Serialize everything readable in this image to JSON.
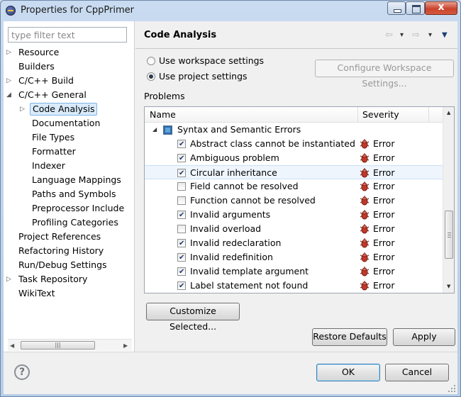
{
  "window": {
    "title": "Properties for CppPrimer",
    "close_glyph": "x"
  },
  "filter": {
    "placeholder": "type filter text"
  },
  "tree": [
    {
      "label": "Resource",
      "twisty": "▷"
    },
    {
      "label": "Builders",
      "twisty": ""
    },
    {
      "label": "C/C++ Build",
      "twisty": "▷"
    },
    {
      "label": "C/C++ General",
      "twisty": "◢"
    },
    {
      "label": "Code Analysis",
      "twisty": "▷"
    },
    {
      "label": "Documentation",
      "twisty": ""
    },
    {
      "label": "File Types",
      "twisty": ""
    },
    {
      "label": "Formatter",
      "twisty": ""
    },
    {
      "label": "Indexer",
      "twisty": ""
    },
    {
      "label": "Language Mappings",
      "twisty": ""
    },
    {
      "label": "Paths and Symbols",
      "twisty": ""
    },
    {
      "label": "Preprocessor Include",
      "twisty": ""
    },
    {
      "label": "Profiling Categories",
      "twisty": ""
    },
    {
      "label": "Project References",
      "twisty": ""
    },
    {
      "label": "Refactoring History",
      "twisty": ""
    },
    {
      "label": "Run/Debug Settings",
      "twisty": ""
    },
    {
      "label": "Task Repository",
      "twisty": "▷"
    },
    {
      "label": "WikiText",
      "twisty": ""
    }
  ],
  "page": {
    "title": "Code Analysis",
    "use_workspace": "Use workspace settings",
    "use_project": "Use project settings",
    "selected_setting": "Use project settings",
    "configure_button": "Configure Workspace Settings...",
    "problems_label": "Problems"
  },
  "table": {
    "col_name": "Name",
    "col_severity": "Severity",
    "group": "Syntax and Semantic Errors",
    "rows": [
      {
        "name": "Abstract class cannot be instantiated",
        "checked": true,
        "severity": "Error"
      },
      {
        "name": "Ambiguous problem",
        "checked": true,
        "severity": "Error"
      },
      {
        "name": "Circular inheritance",
        "checked": true,
        "severity": "Error"
      },
      {
        "name": "Field cannot be resolved",
        "checked": false,
        "severity": "Error"
      },
      {
        "name": "Function cannot be resolved",
        "checked": false,
        "severity": "Error"
      },
      {
        "name": "Invalid arguments",
        "checked": true,
        "severity": "Error"
      },
      {
        "name": "Invalid overload",
        "checked": false,
        "severity": "Error"
      },
      {
        "name": "Invalid redeclaration",
        "checked": true,
        "severity": "Error"
      },
      {
        "name": "Invalid redefinition",
        "checked": true,
        "severity": "Error"
      },
      {
        "name": "Invalid template argument",
        "checked": true,
        "severity": "Error"
      },
      {
        "name": "Label statement not found",
        "checked": true,
        "severity": "Error"
      }
    ]
  },
  "buttons": {
    "customize": "Customize Selected...",
    "restore": "Restore Defaults",
    "apply": "Apply",
    "ok": "OK",
    "cancel": "Cancel"
  },
  "help": {
    "glyph": "?"
  },
  "colors": {
    "error_icon": "#c0392b",
    "selection": "#d9ebfb"
  }
}
